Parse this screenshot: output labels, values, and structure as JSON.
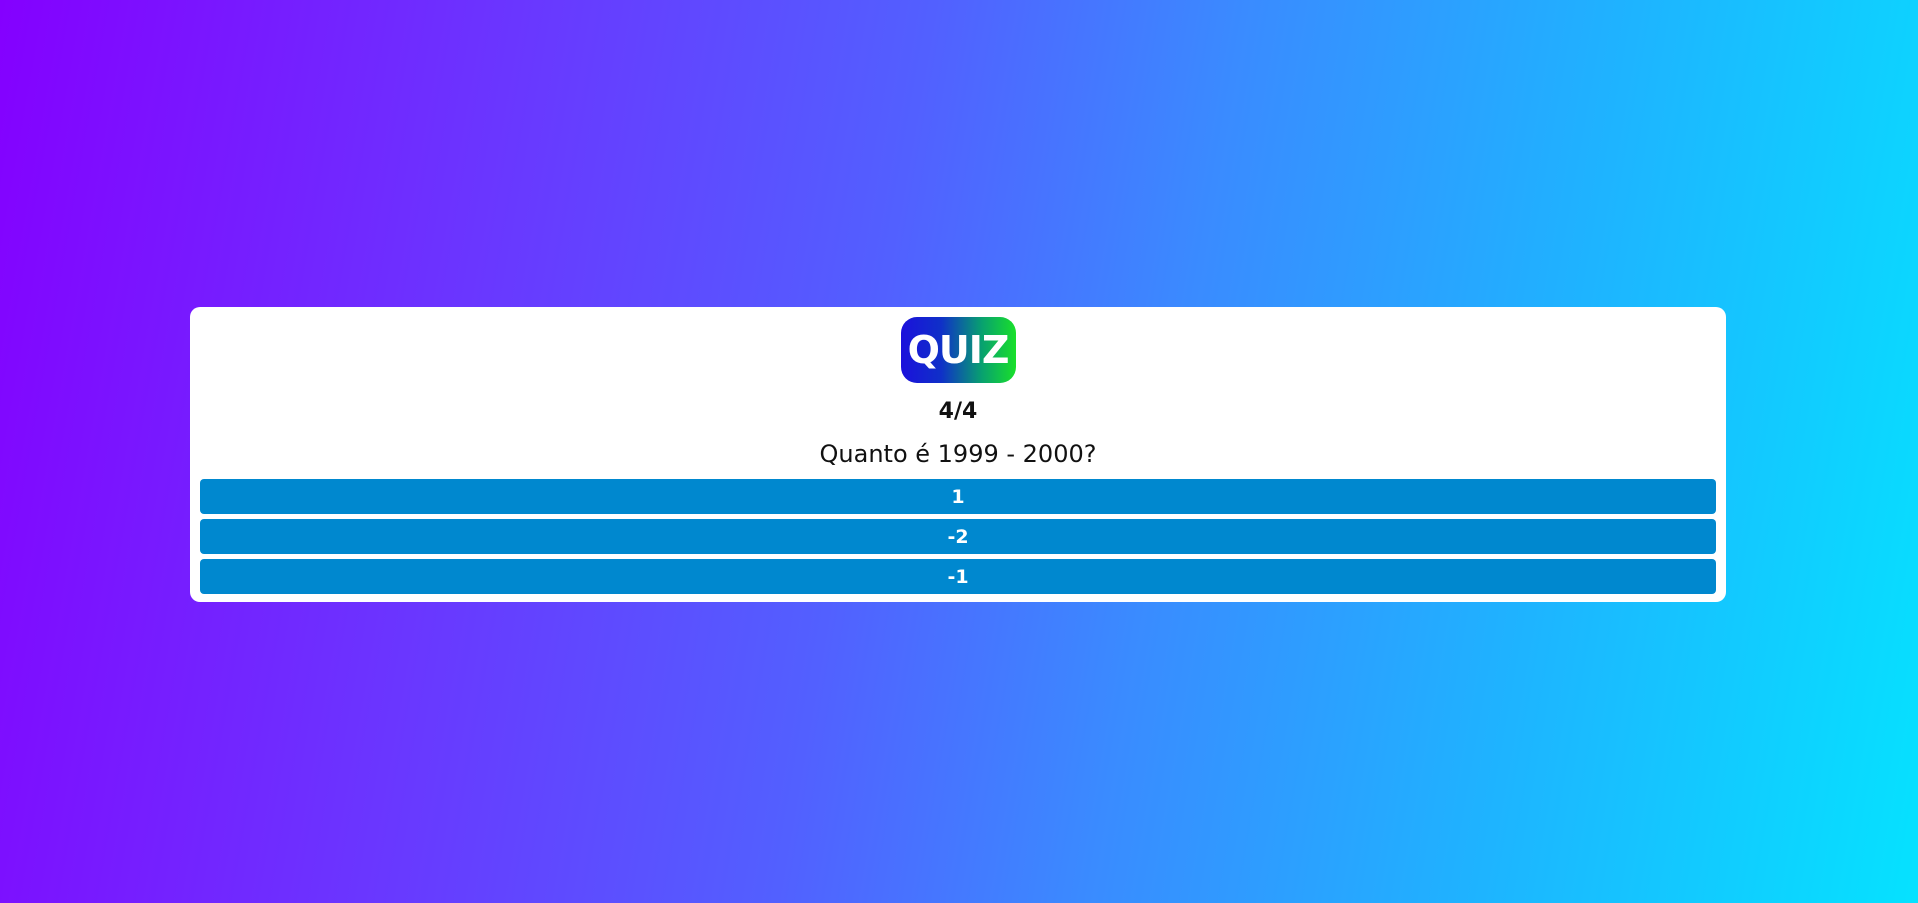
{
  "logo": {
    "text": "QUIZ"
  },
  "progress": {
    "label": "4/4",
    "current": 4,
    "total": 4
  },
  "question": {
    "text": "Quanto é 1999 - 2000?"
  },
  "answers": [
    {
      "label": "1"
    },
    {
      "label": "-2"
    },
    {
      "label": "-1"
    }
  ],
  "colors": {
    "answer_bg": "#0088cf",
    "logo_gradient_start": "#1b10dc",
    "logo_gradient_end": "#19e02a",
    "background_start": "#8400ff",
    "background_end": "#05e2ff"
  }
}
